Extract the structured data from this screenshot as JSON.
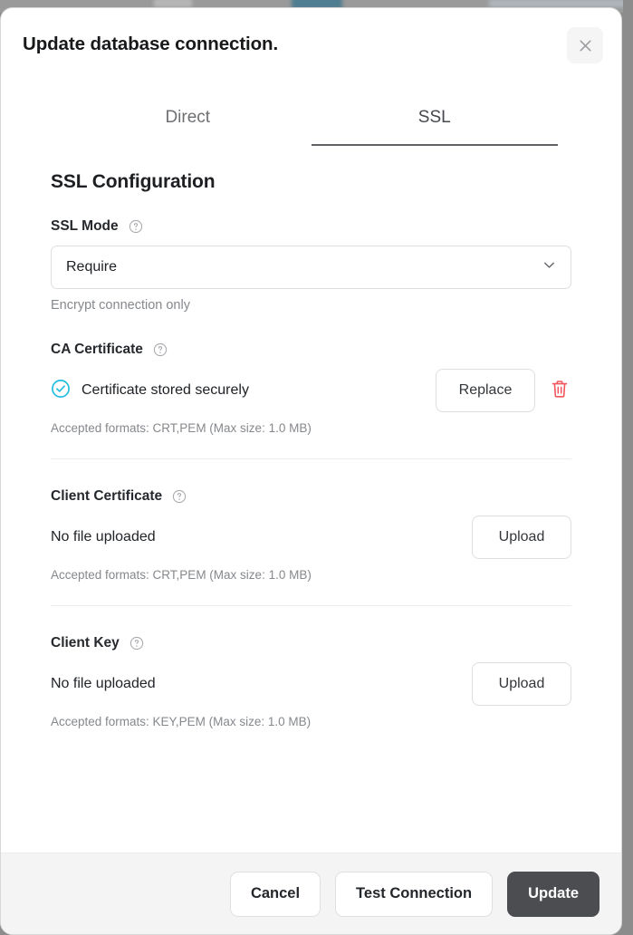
{
  "dialog": {
    "title": "Update database connection.",
    "close_icon": "close-icon"
  },
  "tabs": [
    {
      "label": "Direct",
      "active": false
    },
    {
      "label": "SSL",
      "active": true
    }
  ],
  "ssl_section": {
    "heading": "SSL Configuration",
    "ssl_mode": {
      "label": "SSL Mode",
      "help_icon": "question-mark-icon",
      "value": "Require",
      "helper_text": "Encrypt connection only",
      "chevron_icon": "chevron-down-icon",
      "options": [
        "Require"
      ]
    },
    "ca_certificate": {
      "label": "CA Certificate",
      "help_icon": "question-mark-icon",
      "status_text": "Certificate stored securely",
      "status_icon": "check-circle-icon",
      "replace_label": "Replace",
      "delete_icon": "trash-icon",
      "accepted_text": "Accepted formats: CRT,PEM (Max size: 1.0 MB)"
    },
    "client_certificate": {
      "label": "Client Certificate",
      "help_icon": "question-mark-icon",
      "status_text": "No file uploaded",
      "upload_label": "Upload",
      "accepted_text": "Accepted formats: CRT,PEM (Max size: 1.0 MB)"
    },
    "client_key": {
      "label": "Client Key",
      "help_icon": "question-mark-icon",
      "status_text": "No file uploaded",
      "upload_label": "Upload",
      "accepted_text": "Accepted formats: KEY,PEM (Max size: 1.0 MB)"
    }
  },
  "footer": {
    "cancel_label": "Cancel",
    "test_label": "Test Connection",
    "update_label": "Update"
  },
  "colors": {
    "success": "#22bde0",
    "danger": "#f1555b",
    "primary_button": "#4b4d50",
    "footer_bg": "#f4f4f4",
    "border": "#dededf",
    "muted_text": "#85888c"
  }
}
